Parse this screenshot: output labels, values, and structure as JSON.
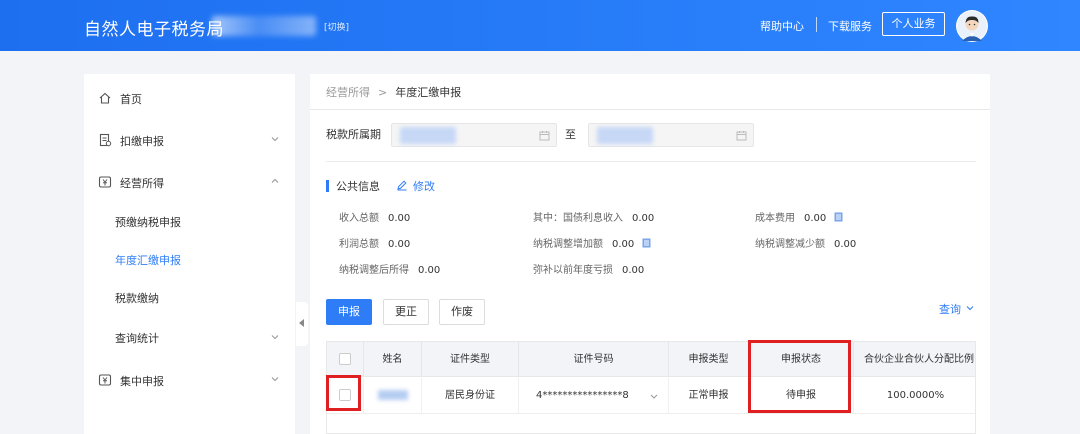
{
  "header": {
    "brand": "自然人电子税务局",
    "switch_label": "[切换]",
    "help_label": "帮助中心",
    "download_label": "下载服务",
    "personal_label": "个人业务"
  },
  "sidebar": {
    "items": [
      {
        "label": "首页",
        "icon": "home-icon"
      },
      {
        "label": "扣缴申报",
        "icon": "document-icon"
      },
      {
        "label": "经营所得",
        "icon": "tax-icon"
      },
      {
        "label": "集中申报",
        "icon": "tax-icon"
      }
    ],
    "sub_items": [
      {
        "label": "预缴纳税申报"
      },
      {
        "label": "年度汇缴申报"
      },
      {
        "label": "税款缴纳"
      },
      {
        "label": "查询统计"
      }
    ]
  },
  "breadcrumb": {
    "parent": "经营所得",
    "separator": ">",
    "current": "年度汇缴申报"
  },
  "filter": {
    "period_label": "税款所属期",
    "to_label": "至"
  },
  "public_info": {
    "title": "公共信息",
    "edit_label": "修改",
    "fields": [
      {
        "label": "收入总额",
        "value": "0.00"
      },
      {
        "label": "其中：国债利息收入",
        "value": "0.00"
      },
      {
        "label": "成本费用",
        "value": "0.00"
      },
      {
        "label": "利润总额",
        "value": "0.00"
      },
      {
        "label": "纳税调整增加额",
        "value": "0.00"
      },
      {
        "label": "纳税调整减少额",
        "value": "0.00"
      },
      {
        "label": "纳税调整后所得",
        "value": "0.00"
      },
      {
        "label": "弥补以前年度亏损",
        "value": "0.00"
      }
    ]
  },
  "toolbar": {
    "declare_label": "申报",
    "correct_label": "更正",
    "void_label": "作废",
    "query_label": "查询"
  },
  "table": {
    "columns": [
      "姓名",
      "证件类型",
      "证件号码",
      "申报类型",
      "申报状态",
      "合伙企业合伙人分配比例"
    ],
    "rows": [
      {
        "id_type": "居民身份证",
        "id_number": "4****************8",
        "declare_type": "正常申报",
        "status": "待申报",
        "ratio": "100.0000%"
      }
    ]
  },
  "colors": {
    "header_blue": "#2f86ff",
    "accent": "#2f7df6",
    "highlight_red": "#e02020"
  }
}
